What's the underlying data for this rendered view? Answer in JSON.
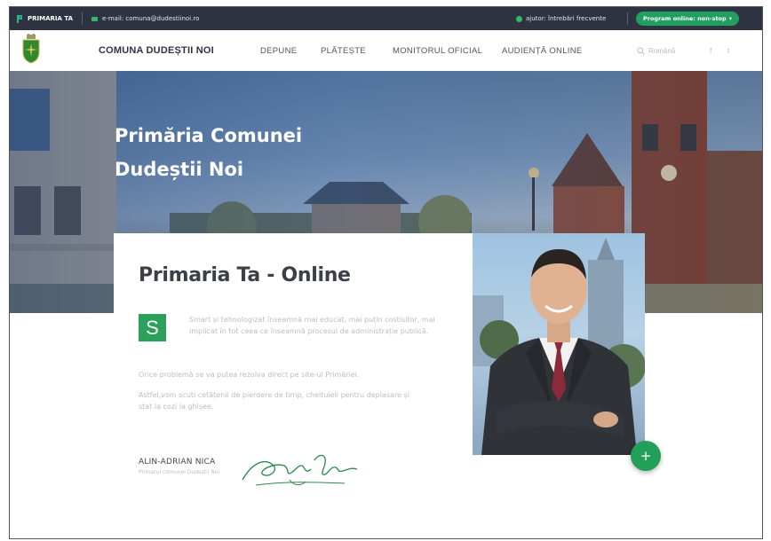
{
  "topbar": {
    "brand": "PRIMARIA TA",
    "email": "e-mail: comuna@dudestiinoi.ro",
    "help": "ajutor: întrebări frecvente",
    "program_button": "Program online: non-stop"
  },
  "nav": {
    "site_name": "COMUNA DUDEȘTII NOI",
    "items": [
      "DEPUNE",
      "PLĂTEȘTE",
      "MONITORUL OFICIAL",
      "AUDIENȚĂ ONLINE"
    ],
    "search_label": "Română",
    "social": [
      "f",
      "t"
    ]
  },
  "hero": {
    "title_line1": "Primăria Comunei",
    "title_line2": "Dudeștii Noi"
  },
  "card": {
    "title": "Primaria Ta - Online",
    "badge_letter": "S",
    "para1": "Smart și tehnologizat înseamnă mai educat, mai puțin costisitor, mai implicat în tot ceea ce înseamnă procesul de administrație publică.",
    "para2": "Orice problemă se va putea rezolva direct pe site-ul Primăriei.",
    "para3": "Astfel,vom scuti cetățenii de pierdere de timp, cheltuieli pentru deplasare și stat la cozi la ghișee.",
    "signer_name": "ALIN-ADRIAN NICA",
    "signer_role": "Primarul comunei Dudeștii Noi",
    "signature_text": "Alin Nica"
  },
  "fab_label": "+",
  "colors": {
    "topbar_bg": "#2d3340",
    "accent_green": "#2aa05a",
    "hero_text": "#ffffff"
  }
}
